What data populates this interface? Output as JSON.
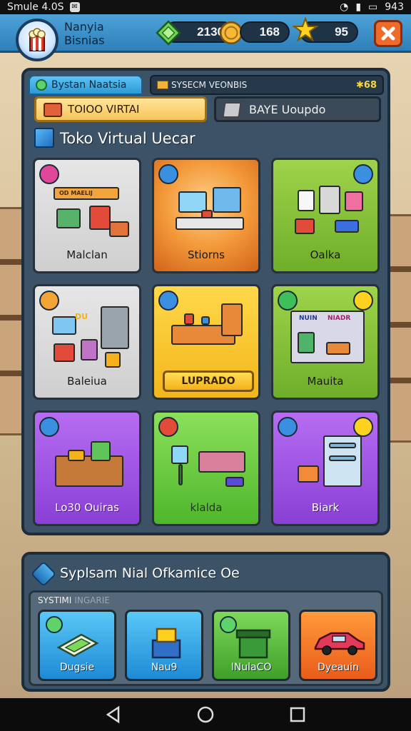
{
  "status_bar": {
    "left": "Smule 4.0S",
    "right": "943"
  },
  "header": {
    "player_line1": "Nanyia",
    "player_line2": "Bisnias",
    "gems": "2130",
    "coins": "168",
    "stars": "95"
  },
  "main": {
    "tab_active": "Bystan Naatsia",
    "tab_info": "SYSECM VEONBIS",
    "tab_info_count": "68",
    "btn_primary": "TOIOO VIRTAI",
    "btn_secondary": "BAYE Uoupdo",
    "section_title": "Toko Virtual Uecar",
    "cards": [
      {
        "label": "Malclan"
      },
      {
        "label": "Stiorns"
      },
      {
        "label": "Oalka"
      },
      {
        "label": "Baleiua"
      },
      {
        "label": "LUPRADO"
      },
      {
        "label": "Mauita"
      },
      {
        "label": "Lo30 Ouiras"
      },
      {
        "label": "klalda"
      },
      {
        "label": "Biark"
      }
    ],
    "card_art_text": {
      "banner": "OD MAELIJ",
      "screen": "DU",
      "sign_a": "NUIN",
      "sign_b": "NIADR"
    }
  },
  "bottom": {
    "title": "Syplsam Nial Ofkamice Oe",
    "sys_label": "SYSTIMI",
    "sys_label_muted": "INGARIE",
    "sys_cards": [
      {
        "label": "Dugsie"
      },
      {
        "label": "Nau9"
      },
      {
        "label": "INulaCO"
      },
      {
        "label": "Dyeauin"
      }
    ]
  },
  "colors": {
    "header": "#2f7fb8",
    "panel": "#3c5266",
    "close": "#f06a2a"
  }
}
